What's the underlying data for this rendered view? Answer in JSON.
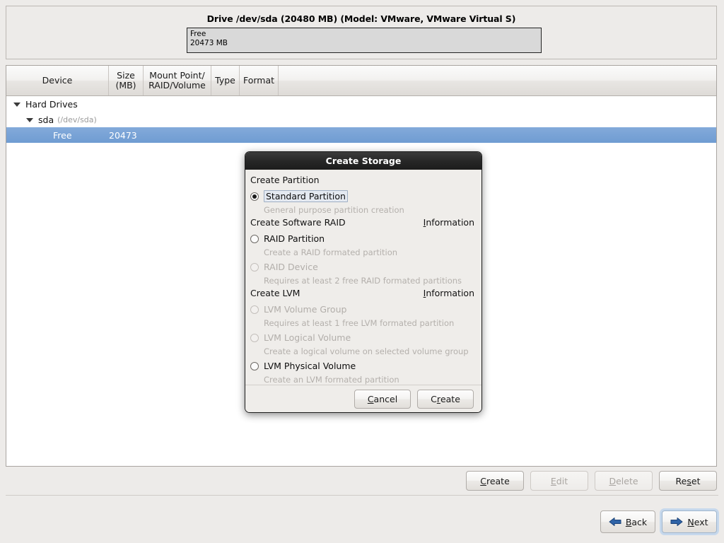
{
  "drive": {
    "title": "Drive /dev/sda (20480 MB) (Model: VMware, VMware Virtual S)",
    "bar": {
      "label": "Free",
      "size": "20473 MB"
    }
  },
  "device_list": {
    "columns": [
      "Device",
      "Size\n(MB)",
      "Mount Point/\nRAID/Volume",
      "Type",
      "Format",
      ""
    ],
    "column_parts": {
      "device": "Device",
      "size_line1": "Size",
      "size_line2": "(MB)",
      "mount_line1": "Mount Point/",
      "mount_line2": "RAID/Volume",
      "type": "Type",
      "format": "Format"
    },
    "rows": [
      {
        "label": "Hard Drives",
        "sub": "",
        "size": "",
        "indent": 0,
        "selected": false,
        "expandable": true
      },
      {
        "label": "sda",
        "sub": "(/dev/sda)",
        "size": "",
        "indent": 1,
        "selected": false,
        "expandable": true
      },
      {
        "label": "Free",
        "sub": "",
        "size": "20473",
        "indent": 2,
        "selected": true,
        "expandable": false
      }
    ]
  },
  "action_bar": {
    "buttons": [
      {
        "label": "Create",
        "mnemonic": "C",
        "enabled": true
      },
      {
        "label": "Edit",
        "mnemonic": "E",
        "enabled": false
      },
      {
        "label": "Delete",
        "mnemonic": "D",
        "enabled": false
      },
      {
        "label": "Reset",
        "mnemonic": "s",
        "enabled": true
      }
    ]
  },
  "nav_bar": {
    "back": {
      "label": "Back",
      "mnemonic": "B",
      "icon": "arrow-left-icon"
    },
    "next": {
      "label": "Next",
      "mnemonic": "N",
      "icon": "arrow-right-icon",
      "focused": true
    }
  },
  "dialog": {
    "title": "Create Storage",
    "sections": [
      {
        "heading": "Create Partition",
        "info": null,
        "options": [
          {
            "label": "Standard Partition",
            "desc": "General purpose partition creation",
            "selected": true,
            "enabled": true,
            "focused": true
          }
        ]
      },
      {
        "heading": "Create Software RAID",
        "info": {
          "label": "Information",
          "mnemonic": "I"
        },
        "options": [
          {
            "label": "RAID Partition",
            "desc": "Create a RAID formated partition",
            "selected": false,
            "enabled": true,
            "focused": false
          },
          {
            "label": "RAID Device",
            "desc": "Requires at least 2 free RAID formated partitions",
            "selected": false,
            "enabled": false,
            "focused": false
          }
        ]
      },
      {
        "heading": "Create LVM",
        "info": {
          "label": "Information",
          "mnemonic": "I"
        },
        "options": [
          {
            "label": "LVM Volume Group",
            "desc": "Requires at least 1 free LVM formated partition",
            "selected": false,
            "enabled": false,
            "focused": false
          },
          {
            "label": "LVM Logical Volume",
            "desc": "Create a logical volume on selected volume group",
            "selected": false,
            "enabled": false,
            "focused": false
          },
          {
            "label": "LVM Physical Volume",
            "desc": "Create an LVM formated partition",
            "selected": false,
            "enabled": true,
            "focused": false
          }
        ]
      }
    ],
    "footer": {
      "cancel": {
        "label": "Cancel",
        "mnemonic": "C"
      },
      "create": {
        "label": "Create",
        "mnemonic": "r"
      }
    }
  },
  "colors": {
    "selection_blue": "#7ba5d4",
    "window_bg": "#edebe9",
    "list_bg": "#ffffff",
    "titlebar_dark": "#262626",
    "arrow_blue": "#2f64a8",
    "focus_ring": "#c6d8ec",
    "disabled_text": "#b2aeaa"
  }
}
